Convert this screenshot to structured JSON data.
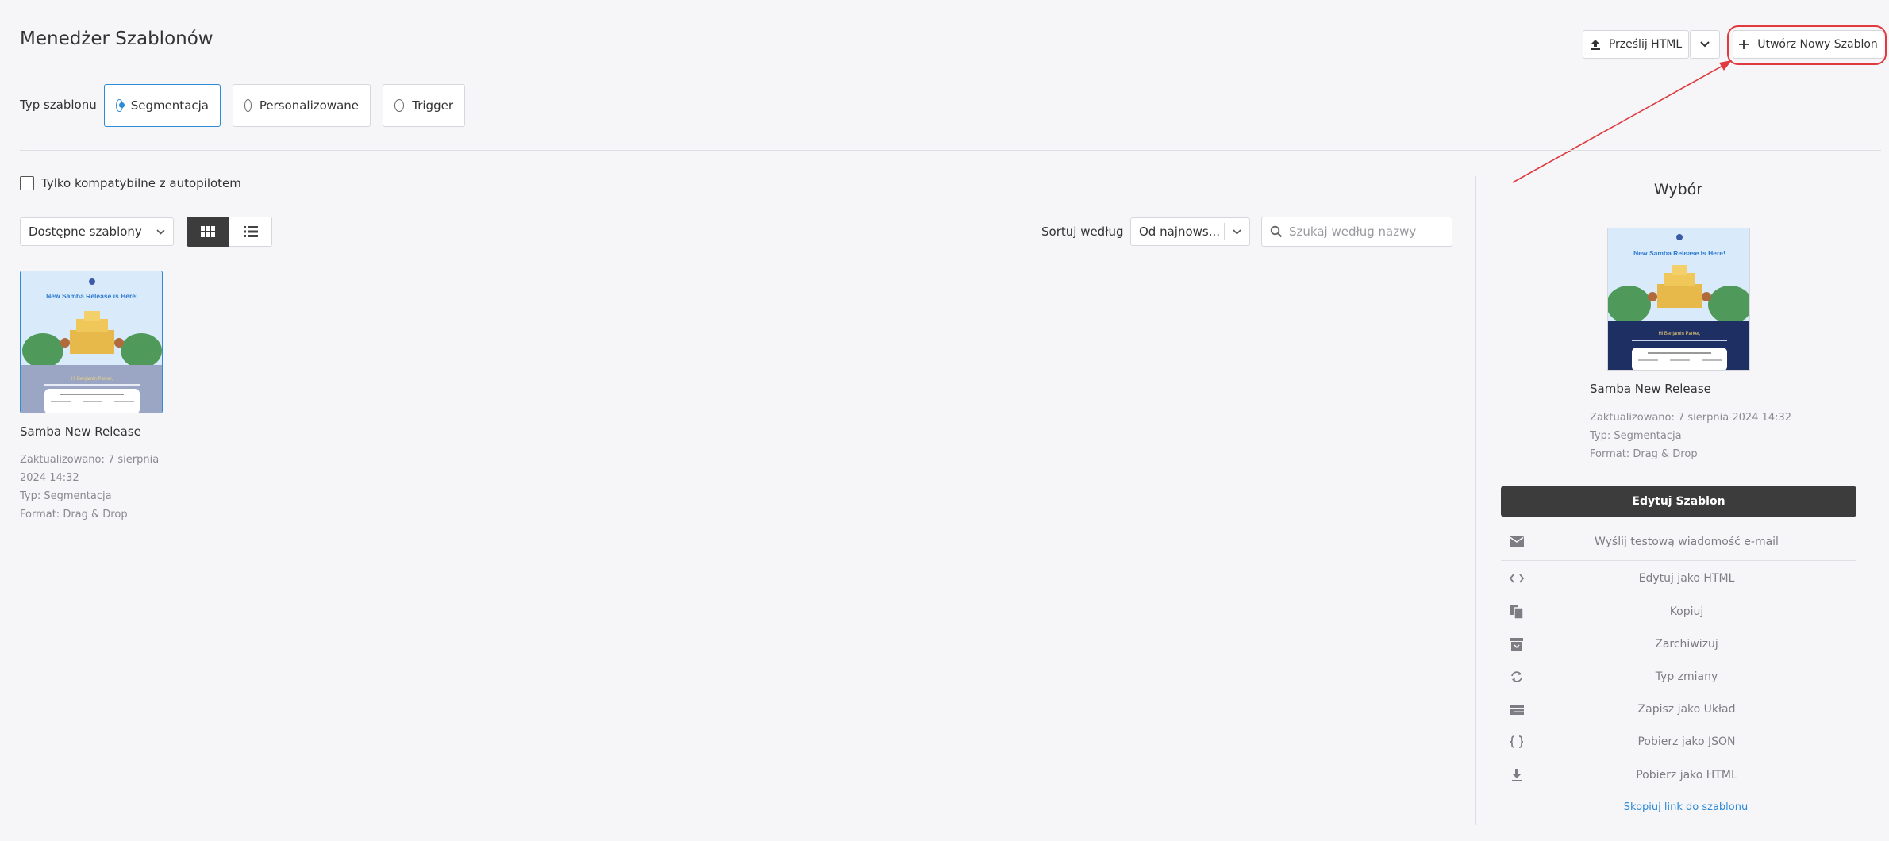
{
  "header": {
    "title": "Menedżer Szablonów",
    "upload_label": "Prześlij HTML",
    "create_label": "Utwórz Nowy Szablon"
  },
  "template_type": {
    "label": "Typ szablonu",
    "options": [
      "Segmentacja",
      "Personalizowane",
      "Trigger"
    ],
    "selected": "Segmentacja"
  },
  "filters": {
    "autopilot_label": "Tylko kompatybilne z autopilotem",
    "autopilot_checked": false,
    "source_select": "Dostępne szablony",
    "view_mode": "grid",
    "sort_label": "Sortuj według",
    "sort_value": "Od najnows...",
    "search_placeholder": "Szukaj według nazwy"
  },
  "templates": [
    {
      "name": "Samba New Release",
      "updated_line1": "Zaktualizowano: 7 sierpnia",
      "updated_line2": "2024 14:32",
      "type": "Typ: Segmentacja",
      "format": "Format: Drag & Drop",
      "preview_headline": "New Samba Release is Here!"
    }
  ],
  "selection": {
    "title": "Wybór",
    "name": "Samba New Release",
    "updated": "Zaktualizowano: 7 sierpnia 2024 14:32",
    "type": "Typ: Segmentacja",
    "format": "Format: Drag & Drop",
    "preview_headline": "New Samba Release is Here!",
    "edit_label": "Edytuj Szablon",
    "actions": [
      {
        "label": "Wyślij testową wiadomość e-mail",
        "icon": "mail-icon"
      },
      {
        "label": "Edytuj jako HTML",
        "icon": "code-icon"
      },
      {
        "label": "Kopiuj",
        "icon": "copy-icon"
      },
      {
        "label": "Zarchiwizuj",
        "icon": "archive-icon"
      },
      {
        "label": "Typ zmiany",
        "icon": "sync-icon"
      },
      {
        "label": "Zapisz jako Układ",
        "icon": "layout-icon"
      },
      {
        "label": "Pobierz jako JSON",
        "icon": "json-braces-icon"
      },
      {
        "label": "Pobierz jako HTML",
        "icon": "download-icon"
      }
    ],
    "copy_link_label": "Skopiuj link do szablonu"
  },
  "colors": {
    "accent": "#2d8ad7",
    "highlight": "#e03a3e",
    "dark_button": "#3c3c3c",
    "background": "#f6f6f9"
  }
}
